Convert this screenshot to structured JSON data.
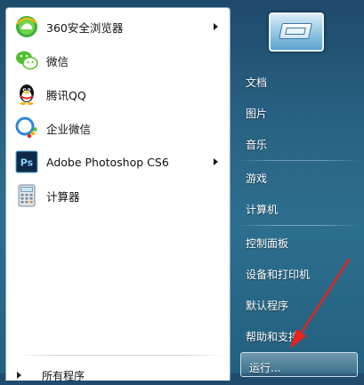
{
  "start_menu": {
    "programs": [
      {
        "label": "360安全浏览器",
        "icon": "browser-360-icon",
        "has_submenu": true
      },
      {
        "label": "微信",
        "icon": "wechat-icon",
        "has_submenu": false
      },
      {
        "label": "腾讯QQ",
        "icon": "qq-penguin-icon",
        "has_submenu": false
      },
      {
        "label": "企业微信",
        "icon": "wecom-icon",
        "has_submenu": false
      },
      {
        "label": "Adobe Photoshop CS6",
        "icon": "photoshop-icon",
        "has_submenu": true
      },
      {
        "label": "计算器",
        "icon": "calculator-icon",
        "has_submenu": false
      }
    ],
    "all_programs_label": "所有程序"
  },
  "right_menu": {
    "user_picture_icon": "user-picture-icon",
    "items": [
      {
        "label": "文档"
      },
      {
        "label": "图片"
      },
      {
        "label": "音乐"
      },
      {
        "label": "游戏"
      },
      {
        "label": "计算机"
      },
      {
        "label": "控制面板"
      },
      {
        "label": "设备和打印机"
      },
      {
        "label": "默认程序"
      },
      {
        "label": "帮助和支持"
      }
    ],
    "run_label": "运行..."
  },
  "colors": {
    "accent_red": "#e8231d",
    "panel_white": "#ffffff",
    "background_blue": "#2a6384"
  }
}
